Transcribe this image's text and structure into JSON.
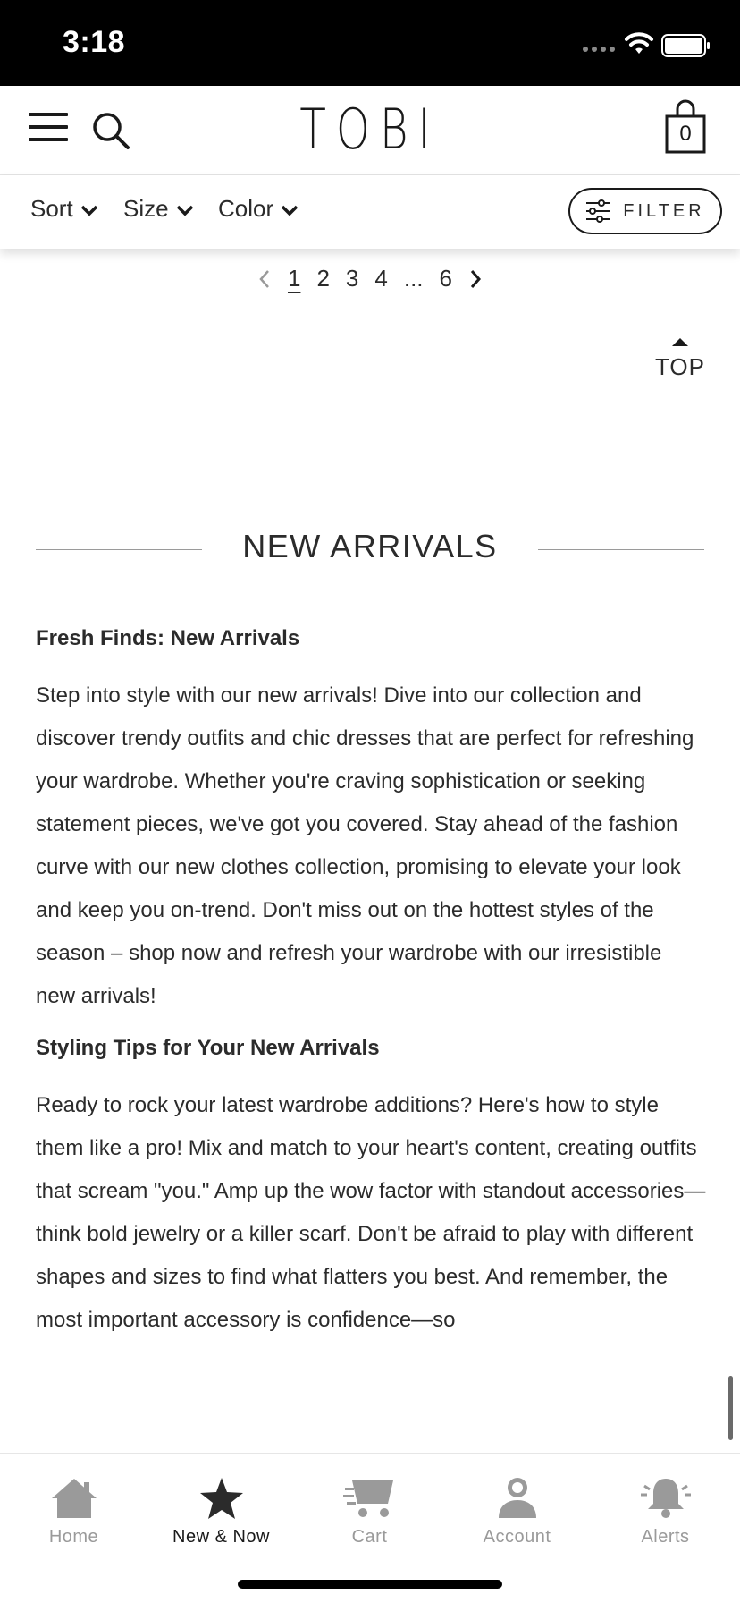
{
  "status_bar": {
    "time": "3:18"
  },
  "header": {
    "logo": "TOBI",
    "bag_count": "0"
  },
  "filters": {
    "sort_label": "Sort",
    "size_label": "Size",
    "color_label": "Color",
    "filter_label": "FILTER"
  },
  "pagination": {
    "pages": [
      "1",
      "2",
      "3",
      "4",
      "...",
      "6"
    ],
    "current": "1"
  },
  "top_link": "TOP",
  "section": {
    "title": "NEW ARRIVALS",
    "heading1": "Fresh Finds: New Arrivals",
    "paragraph1": "Step into style with our new arrivals! Dive into our collection and discover trendy outfits and chic dresses that are perfect for refreshing your wardrobe. Whether you're craving sophistication or seeking statement pieces, we've got you covered. Stay ahead of the fashion curve with our new clothes collection, promising to elevate your look and keep you on-trend. Don't miss out on the hottest styles of the season – shop now and refresh your wardrobe with our irresistible new arrivals!",
    "heading2": "Styling Tips for Your New Arrivals",
    "paragraph2": "Ready to rock your latest wardrobe additions? Here's how to style them like a pro! Mix and match to your heart's content, creating outfits that scream \"you.\" Amp up the wow factor with standout accessories—think bold jewelry or a killer scarf. Don't be afraid to play with different shapes and sizes to find what flatters you best. And remember, the most important accessory is confidence—so"
  },
  "tab_bar": {
    "home": "Home",
    "new_now": "New & Now",
    "cart": "Cart",
    "account": "Account",
    "alerts": "Alerts",
    "active": "New & Now"
  },
  "colors": {
    "text": "#2b2b2b",
    "inactive_tab": "#9a9a9a",
    "active_tab": "#1a1a1a",
    "status_bar_bg": "#000000"
  }
}
